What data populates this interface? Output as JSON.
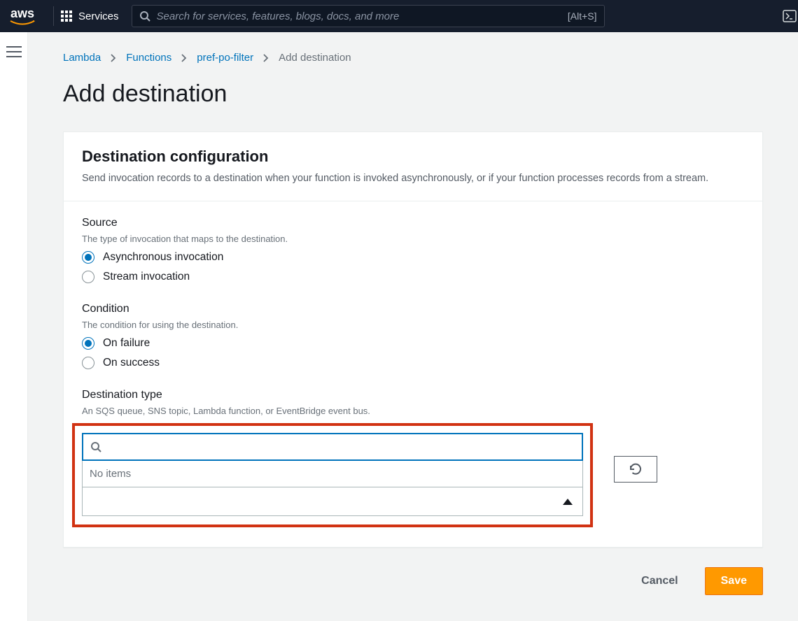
{
  "nav": {
    "logo_text": "aws",
    "services_label": "Services",
    "search_placeholder": "Search for services, features, blogs, docs, and more",
    "search_shortcut": "[Alt+S]"
  },
  "breadcrumbs": {
    "items": [
      "Lambda",
      "Functions",
      "pref-po-filter"
    ],
    "current": "Add destination"
  },
  "page": {
    "title": "Add destination"
  },
  "panel": {
    "title": "Destination configuration",
    "desc": "Send invocation records to a destination when your function is invoked asynchronously, or if your function processes records from a stream."
  },
  "source": {
    "label": "Source",
    "desc": "The type of invocation that maps to the destination.",
    "options": [
      "Asynchronous invocation",
      "Stream invocation"
    ],
    "selected": 0
  },
  "condition": {
    "label": "Condition",
    "desc": "The condition for using the destination.",
    "options": [
      "On failure",
      "On success"
    ],
    "selected": 0
  },
  "dest_type": {
    "label": "Destination type",
    "desc": "An SQS queue, SNS topic, Lambda function, or EventBridge event bus.",
    "search_value": "",
    "no_items": "No items"
  },
  "buttons": {
    "cancel": "Cancel",
    "save": "Save"
  }
}
